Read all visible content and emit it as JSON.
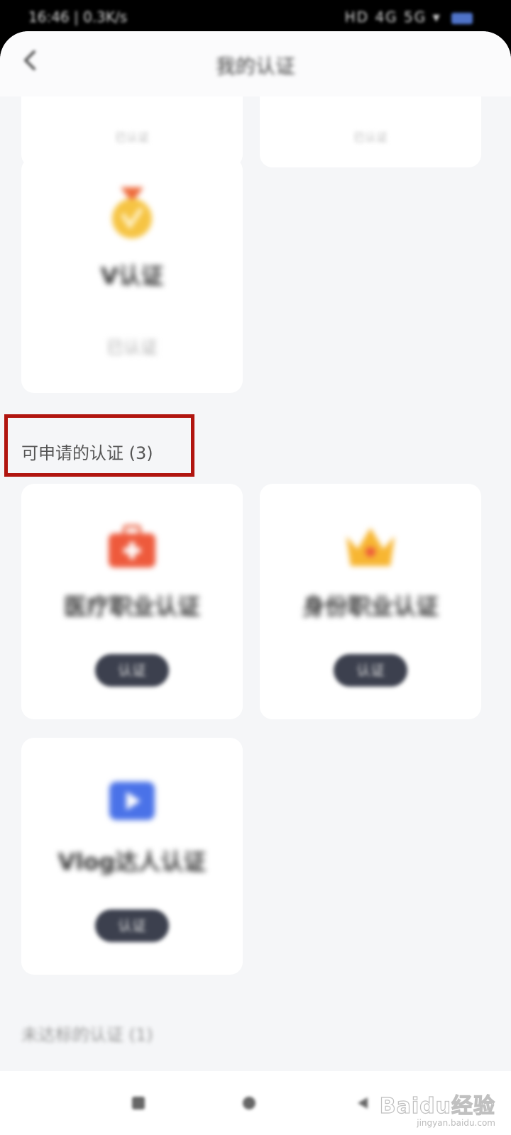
{
  "status_bar": {
    "time": "16:46 | 0.3K/s",
    "indicators": "HD 4G 5G ▾"
  },
  "header": {
    "title": "我的认证",
    "back_icon": "chevron-left-icon"
  },
  "obtained": {
    "top_cards": [
      {
        "label": "已认证"
      },
      {
        "label": "已认证"
      }
    ],
    "v_card": {
      "icon": "medal-icon",
      "title": "V认证",
      "status": "已认证"
    }
  },
  "available": {
    "title": "可申请的认证 (3)",
    "cards": [
      {
        "icon": "medical-kit-icon",
        "title": "医疗职业认证",
        "button": "认证"
      },
      {
        "icon": "crown-icon",
        "title": "身份职业认证",
        "button": "认证"
      },
      {
        "icon": "video-play-icon",
        "title": "Vlog达人认证",
        "button": "认证"
      }
    ]
  },
  "unavailable": {
    "title": "未达标的认证 (1)"
  },
  "colors": {
    "highlight_box": "#b1150f",
    "button_dark": "#3c404e",
    "background": "#f5f6f8"
  },
  "watermark": {
    "main": "Baidu经验",
    "sub": "jingyan.baidu.com"
  }
}
